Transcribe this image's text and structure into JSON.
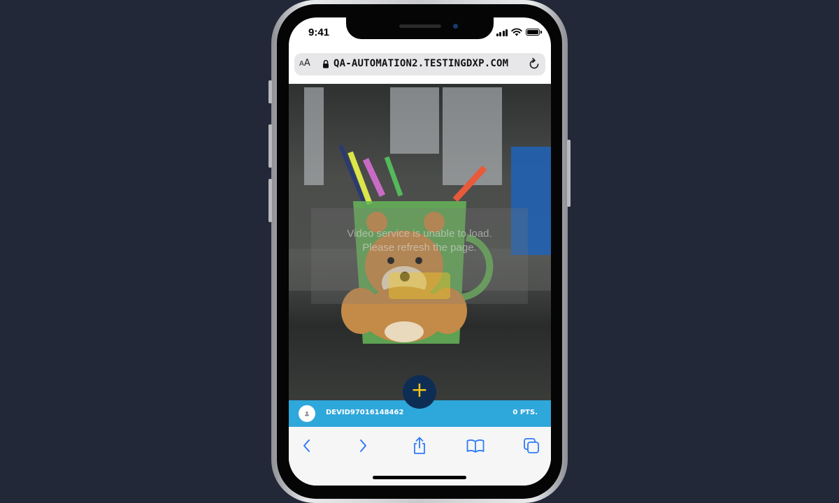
{
  "status_bar": {
    "time": "9:41"
  },
  "browser": {
    "text_size_label": "AA",
    "url": "QA-AUTOMATION2.TESTINGDXP.COM"
  },
  "video": {
    "error_line1": "Video service is unable to load.",
    "error_line2": "Please refresh the page."
  },
  "fab": {
    "label": "+"
  },
  "user_bar": {
    "username": "DEVID97016148462",
    "points": "0 PTS."
  },
  "colors": {
    "background": "#222838",
    "user_bar": "#2ea7da",
    "fab_bg": "#0e2d55",
    "fab_plus": "#f2c417",
    "safari_icons": "#2f7cf6"
  },
  "icons": {
    "lock": "lock-icon",
    "reload": "reload-icon",
    "back": "chevron-left-icon",
    "forward": "chevron-right-icon",
    "share": "share-icon",
    "bookmarks": "book-icon",
    "tabs": "tabs-icon",
    "avatar": "user-icon"
  }
}
